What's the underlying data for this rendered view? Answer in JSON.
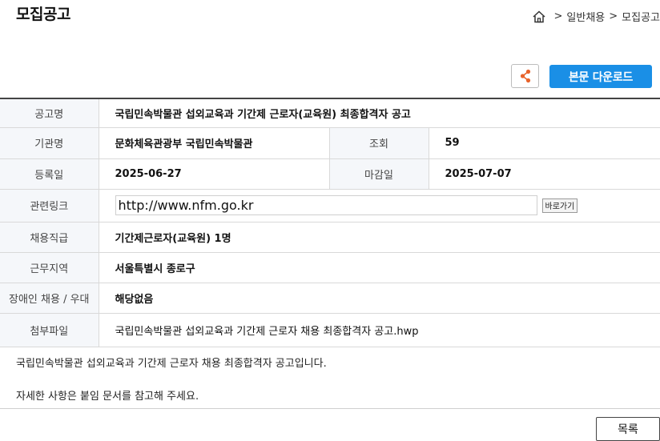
{
  "page_title": "모집공고",
  "breadcrumb": {
    "items": [
      "일반채용",
      "모집공고"
    ],
    "separator": ">"
  },
  "actions": {
    "download_label": "본문 다운로드"
  },
  "details": {
    "title_label": "공고명",
    "title_value": "국립민속박물관 섭외교육과 기간제 근로자(교육원) 최종합격자 공고",
    "org_label": "기관명",
    "org_value": "문화체육관광부 국립민속박물관",
    "views_label": "조회",
    "views_value": "59",
    "reg_label": "등록일",
    "reg_value": "2025-06-27",
    "deadline_label": "마감일",
    "deadline_value": "2025-07-07",
    "link_label": "관련링크",
    "link_value": "http://www.nfm.go.kr",
    "link_go_label": "바로가기",
    "position_label": "채용직급",
    "position_value": "기간제근로자(교육원) 1명",
    "region_label": "근무지역",
    "region_value": "서울특별시 종로구",
    "disabled_label": "장애인 채용 / 우대",
    "disabled_value": "해당없음",
    "attach_label": "첨부파일",
    "attach_value": "국립민속박물관 섭외교육과 기간제 근로자 채용 최종합격자 공고.hwp"
  },
  "body_text": {
    "line1": "국립민속박물관 섭외교육과 기간제 근로자 채용 최종합격자 공고입니다.",
    "line2": "자세한 사항은 붙임 문서를 참고해 주세요."
  },
  "list_button_label": "목록",
  "colors": {
    "accent": "#1a8fe6",
    "share_icon": "#e8632b",
    "header_bg": "#f5f7fa"
  }
}
